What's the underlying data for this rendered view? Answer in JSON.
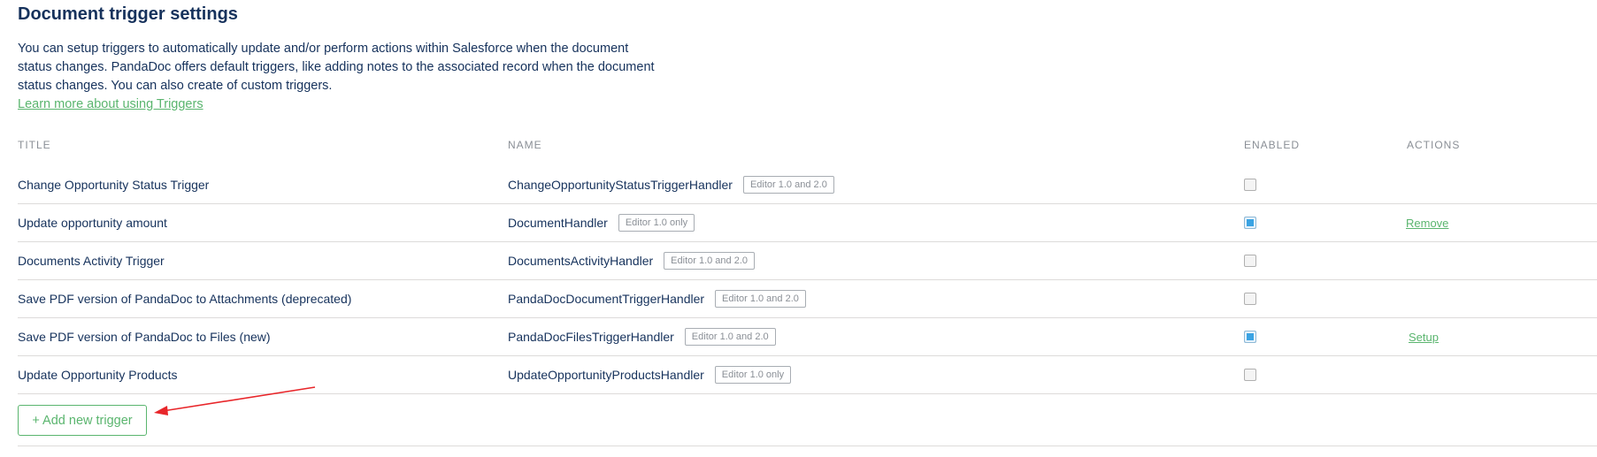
{
  "page": {
    "title": "Document trigger settings",
    "description": "You can setup triggers to automatically update and/or perform actions within Salesforce when the document status changes. PandaDoc offers default triggers, like adding notes to the associated record when the document status changes. You can also create of custom triggers.",
    "learn_more": "Learn more about using Triggers"
  },
  "table": {
    "headers": {
      "title": "TITLE",
      "name": "NAME",
      "enabled": "ENABLED",
      "actions": "ACTIONS"
    },
    "rows": [
      {
        "title": "Change Opportunity Status Trigger",
        "name": "ChangeOpportunityStatusTriggerHandler",
        "badge": "Editor 1.0 and 2.0",
        "enabled": false,
        "action": ""
      },
      {
        "title": "Update opportunity amount",
        "name": "DocumentHandler",
        "badge": "Editor 1.0 only",
        "enabled": true,
        "action": "Remove"
      },
      {
        "title": "Documents Activity Trigger",
        "name": "DocumentsActivityHandler",
        "badge": "Editor 1.0 and 2.0",
        "enabled": false,
        "action": ""
      },
      {
        "title": "Save PDF version of PandaDoc to Attachments (deprecated)",
        "name": "PandaDocDocumentTriggerHandler",
        "badge": "Editor 1.0 and 2.0",
        "enabled": false,
        "action": ""
      },
      {
        "title": "Save PDF version of PandaDoc to Files (new)",
        "name": "PandaDocFilesTriggerHandler",
        "badge": "Editor 1.0 and 2.0",
        "enabled": true,
        "action": "Setup"
      },
      {
        "title": "Update Opportunity Products",
        "name": "UpdateOpportunityProductsHandler",
        "badge": "Editor 1.0 only",
        "enabled": false,
        "action": ""
      }
    ]
  },
  "add_button": {
    "label": "+ Add new trigger"
  },
  "colors": {
    "text": "#16325c",
    "accent_green": "#5ab56e",
    "checkbox_checked": "#3aa3e3",
    "annotation_arrow": "#e8262a"
  },
  "icons": {
    "annotation": "red-arrow-icon"
  }
}
